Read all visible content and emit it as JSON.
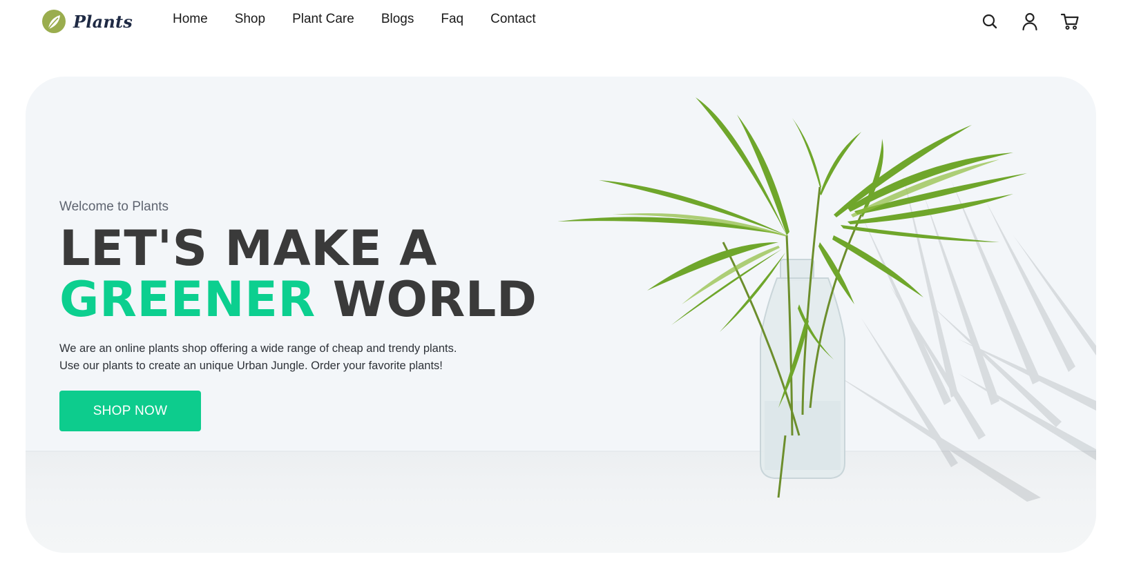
{
  "brand": {
    "name": "Plants",
    "logo_icon": "leaf-logo-icon",
    "logo_color": "#9aad4e"
  },
  "nav": {
    "items": [
      {
        "label": "Home"
      },
      {
        "label": "Shop"
      },
      {
        "label": "Plant Care"
      },
      {
        "label": "Blogs"
      },
      {
        "label": "Faq"
      },
      {
        "label": "Contact"
      }
    ]
  },
  "header_icons": [
    "search-icon",
    "user-icon",
    "cart-icon"
  ],
  "hero": {
    "welcome": "Welcome to Plants",
    "headline_line1": "LET'S MAKE A",
    "headline_green": "GREENER",
    "headline_rest": "WORLD",
    "description_line1": "We are an online plants shop offering a wide range of cheap and trendy plants.",
    "description_line2": "Use our plants to create an unique Urban Jungle. Order your favorite plants!",
    "cta_label": "SHOP NOW",
    "accent_color": "#0ccf8f",
    "image": "palm-leaves-in-glass-vase-illustration"
  }
}
